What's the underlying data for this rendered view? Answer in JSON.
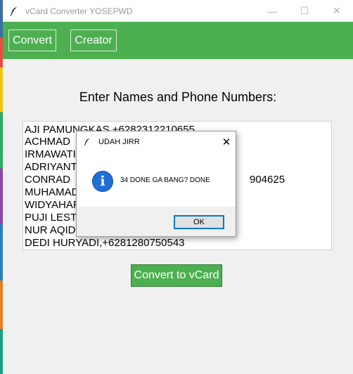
{
  "window": {
    "title": "vCard Converter YOSEPWD",
    "minimize_glyph": "—",
    "maximize_glyph": "☐",
    "close_glyph": "✕",
    "icon": "feather-icon"
  },
  "toolbar": {
    "convert_label": "Convert",
    "creator_label": "Creator",
    "bg_color": "#4caf50"
  },
  "main": {
    "heading": "Enter Names and Phone Numbers:",
    "lines": [
      "AJI PAMUNGKAS,+6282312210655",
      "ACHMAD",
      "IRMAWATI",
      "ADRIYANT",
      "CONRAD",
      "MUHAMAD",
      "WIDYAHAR",
      "PUJI LEST",
      "NUR AQID",
      "DEDI HURYADI,+6281280750543"
    ],
    "conrad_tail": "904625",
    "convert_vcard_label": "Convert to vCard"
  },
  "dialog": {
    "title": "UDAH JIRR",
    "message": "34 DONE GA BANG? DONE",
    "ok_label": "OK",
    "icon": "info-icon",
    "accent_color": "#0078d7"
  }
}
